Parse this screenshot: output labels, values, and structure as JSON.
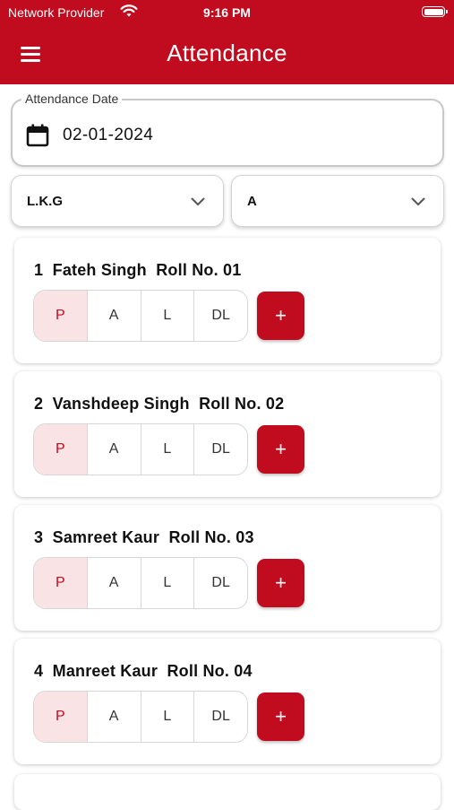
{
  "status_bar": {
    "carrier": "Network Provider",
    "time": "9:16 PM"
  },
  "header": {
    "title": "Attendance",
    "menu_icon": "hamburger-menu-icon"
  },
  "colors": {
    "brand": "#c00c1e",
    "selected_bg": "#f9e3e5"
  },
  "date_field": {
    "label": "Attendance Date",
    "value": "02-01-2024",
    "icon": "calendar-icon"
  },
  "class_select": {
    "value": "L.K.G"
  },
  "section_select": {
    "value": "A"
  },
  "attendance_options": [
    "P",
    "A",
    "L",
    "DL"
  ],
  "add_label": "+",
  "students": [
    {
      "number": "1",
      "name": "Fateh Singh",
      "roll": "Roll No. 01",
      "status": "P"
    },
    {
      "number": "2",
      "name": "Vanshdeep Singh",
      "roll": "Roll No. 02",
      "status": "P"
    },
    {
      "number": "3",
      "name": "Samreet Kaur",
      "roll": "Roll No. 03",
      "status": "P"
    },
    {
      "number": "4",
      "name": "Manreet Kaur",
      "roll": "Roll No. 04",
      "status": "P"
    }
  ]
}
